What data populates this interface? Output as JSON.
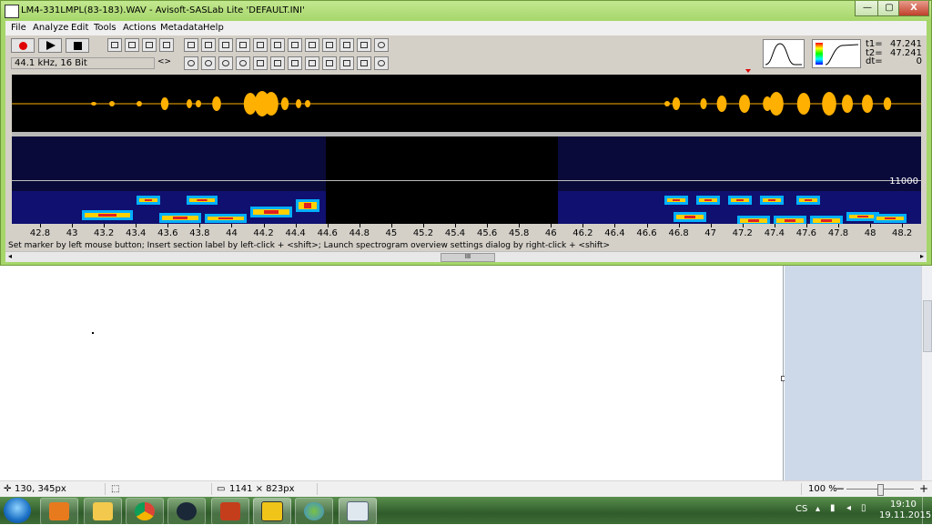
{
  "window": {
    "title": "LM4-331LMPL(83-183).WAV - Avisoft-SASLab Lite  'DEFAULT.INI'",
    "minimize_label": "—",
    "maximize_label": "▢",
    "close_label": "X"
  },
  "menu": [
    "File",
    "Analyze",
    "Edit",
    "Tools",
    "Actions",
    "Metadata",
    "Help"
  ],
  "toolbar": {
    "format_label": "44.1 kHz, 16 Bit",
    "format_arrows": "<>",
    "t1_label": "t1=",
    "t1_value": "47.241",
    "t2_label": "t2=",
    "t2_value": "47.241",
    "dt_label": "dt=",
    "dt_value": "0",
    "record_icon": "record-icon",
    "play_icon": "play-icon",
    "stop_icon": "stop-icon"
  },
  "spectrogram": {
    "freq_label": "11000",
    "accent_color": "#ffb000"
  },
  "axis": {
    "ticks": [
      "42.8",
      "43",
      "43.2",
      "43.4",
      "43.6",
      "43.8",
      "44",
      "44.2",
      "44.4",
      "44.6",
      "44.8",
      "45",
      "45.2",
      "45.4",
      "45.6",
      "45.8",
      "46",
      "46.2",
      "46.4",
      "46.6",
      "46.8",
      "47",
      "47.2",
      "47.4",
      "47.6",
      "47.8",
      "48",
      "48.2"
    ]
  },
  "status_text": "Set marker by left mouse button; Insert section label by left-click + <shift>; Launch spectrogram overview settings dialog by right-click + <shift>",
  "scroll_thumb": "III",
  "paint_status": {
    "cursor_pos": "130, 345px",
    "image_size": "1141 × 823px",
    "zoom": "100 %",
    "zoom_minus": "−",
    "zoom_plus": "+"
  },
  "taskbar": {
    "lang": "CS",
    "time": "19:10",
    "date": "19.11.2015"
  }
}
